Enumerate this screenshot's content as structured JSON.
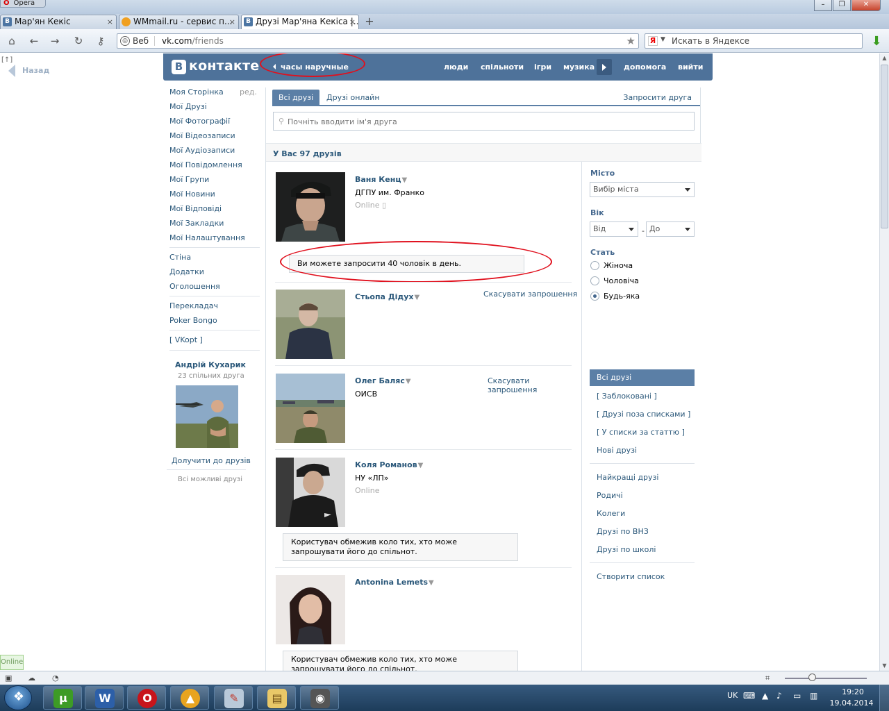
{
  "browser": {
    "app_name": "Opera",
    "tabs": [
      {
        "label": "Мар'ян Кекіс",
        "favicon": "B"
      },
      {
        "label": "WMmail.ru - сервис п...",
        "favicon": "wm"
      },
      {
        "label": "Друзі Мар'яна Кекіса |...",
        "favicon": "B"
      }
    ],
    "url_prefix": "Веб",
    "url_host": "vk.com",
    "url_path": "/friends",
    "search_placeholder": "Искать в Яндексе",
    "search_engine_glyph": "Я",
    "back_label": "Назад",
    "back_sup": "[↑]"
  },
  "vk": {
    "logo_b": "В",
    "logo_text": "контакте",
    "status": "часы наручные",
    "nav": [
      "люди",
      "спільноти",
      "ігри",
      "музика",
      "допомога",
      "вийти"
    ],
    "left_menu": {
      "edit": "ред.",
      "items": [
        "Моя Сторінка",
        "Мої Друзі",
        "Мої Фотографії",
        "Мої Відеозаписи",
        "Мої Аудіозаписи",
        "Мої Повідомлення",
        "Мої Групи",
        "Мої Новини",
        "Мої Відповіді",
        "Мої Закладки",
        "Мої Налаштування"
      ],
      "group2": [
        "Стіна",
        "Додатки",
        "Оголошення"
      ],
      "group3": [
        "Перекладач",
        "Poker Bongo"
      ],
      "group4": [
        "[ VKopt ]"
      ]
    },
    "suggestion": {
      "name": "Андрій Кухарик",
      "common": "23 спільних друга",
      "add": "Долучити до друзів",
      "all": "Всі можливі друзі"
    },
    "tabs": {
      "all": "Всі друзі",
      "online": "Друзі онлайн",
      "invite": "Запросити друга"
    },
    "search_placeholder": "Почніть вводити ім'я друга",
    "count_text": "У Вас 97 друзів",
    "friends": [
      {
        "name": "Ваня Кенц",
        "sub": "ДГПУ им. Франко",
        "online": "Online"
      },
      {
        "name": "Стьопа Дідух",
        "cancel": "Скасувати запрошення"
      },
      {
        "name": "Олег Баляс",
        "sub": "ОИСВ",
        "cancel": "Скасувати запрошення"
      },
      {
        "name": "Коля Романов",
        "sub": "НУ «ЛП»",
        "online": "Online"
      },
      {
        "name": "Antonina Lemets"
      }
    ],
    "notices": {
      "invite_limit": "Ви можете запросити 40 чоловік в день.",
      "restricted_1": "Користувач обмежив коло тих, хто може запрошувати його до спільнот.",
      "restricted_2": "Користувач обмежив коло тих, хто може запрошувати його до спільнот."
    },
    "filters": {
      "city_label": "Місто",
      "city_value": "Вибір міста",
      "age_label": "Вік",
      "age_from": "Від",
      "age_to": "До",
      "age_dash": "-",
      "sex_label": "Стать",
      "sex_options": [
        "Жіноча",
        "Чоловіча",
        "Будь-яка"
      ],
      "sex_selected": "Будь-яка",
      "lists": [
        "Всі друзі",
        "[ Заблоковані ]",
        "[ Друзі поза списками ]",
        "[ У списки за статтю ]",
        "Нові друзі"
      ],
      "lists2": [
        "Найкращі друзі",
        "Родичі",
        "Колеги",
        "Друзі по ВНЗ",
        "Друзі по школі"
      ],
      "create": "Створити список"
    },
    "colors": {
      "header": "#4e729a",
      "link": "#2b587a",
      "active_tab": "#5b7fa6",
      "annotation": "#e0101d"
    }
  },
  "status_bar": {
    "online_badge": "Online"
  },
  "taskbar": {
    "lang": "UK",
    "time": "19:20",
    "date": "19.04.2014"
  }
}
